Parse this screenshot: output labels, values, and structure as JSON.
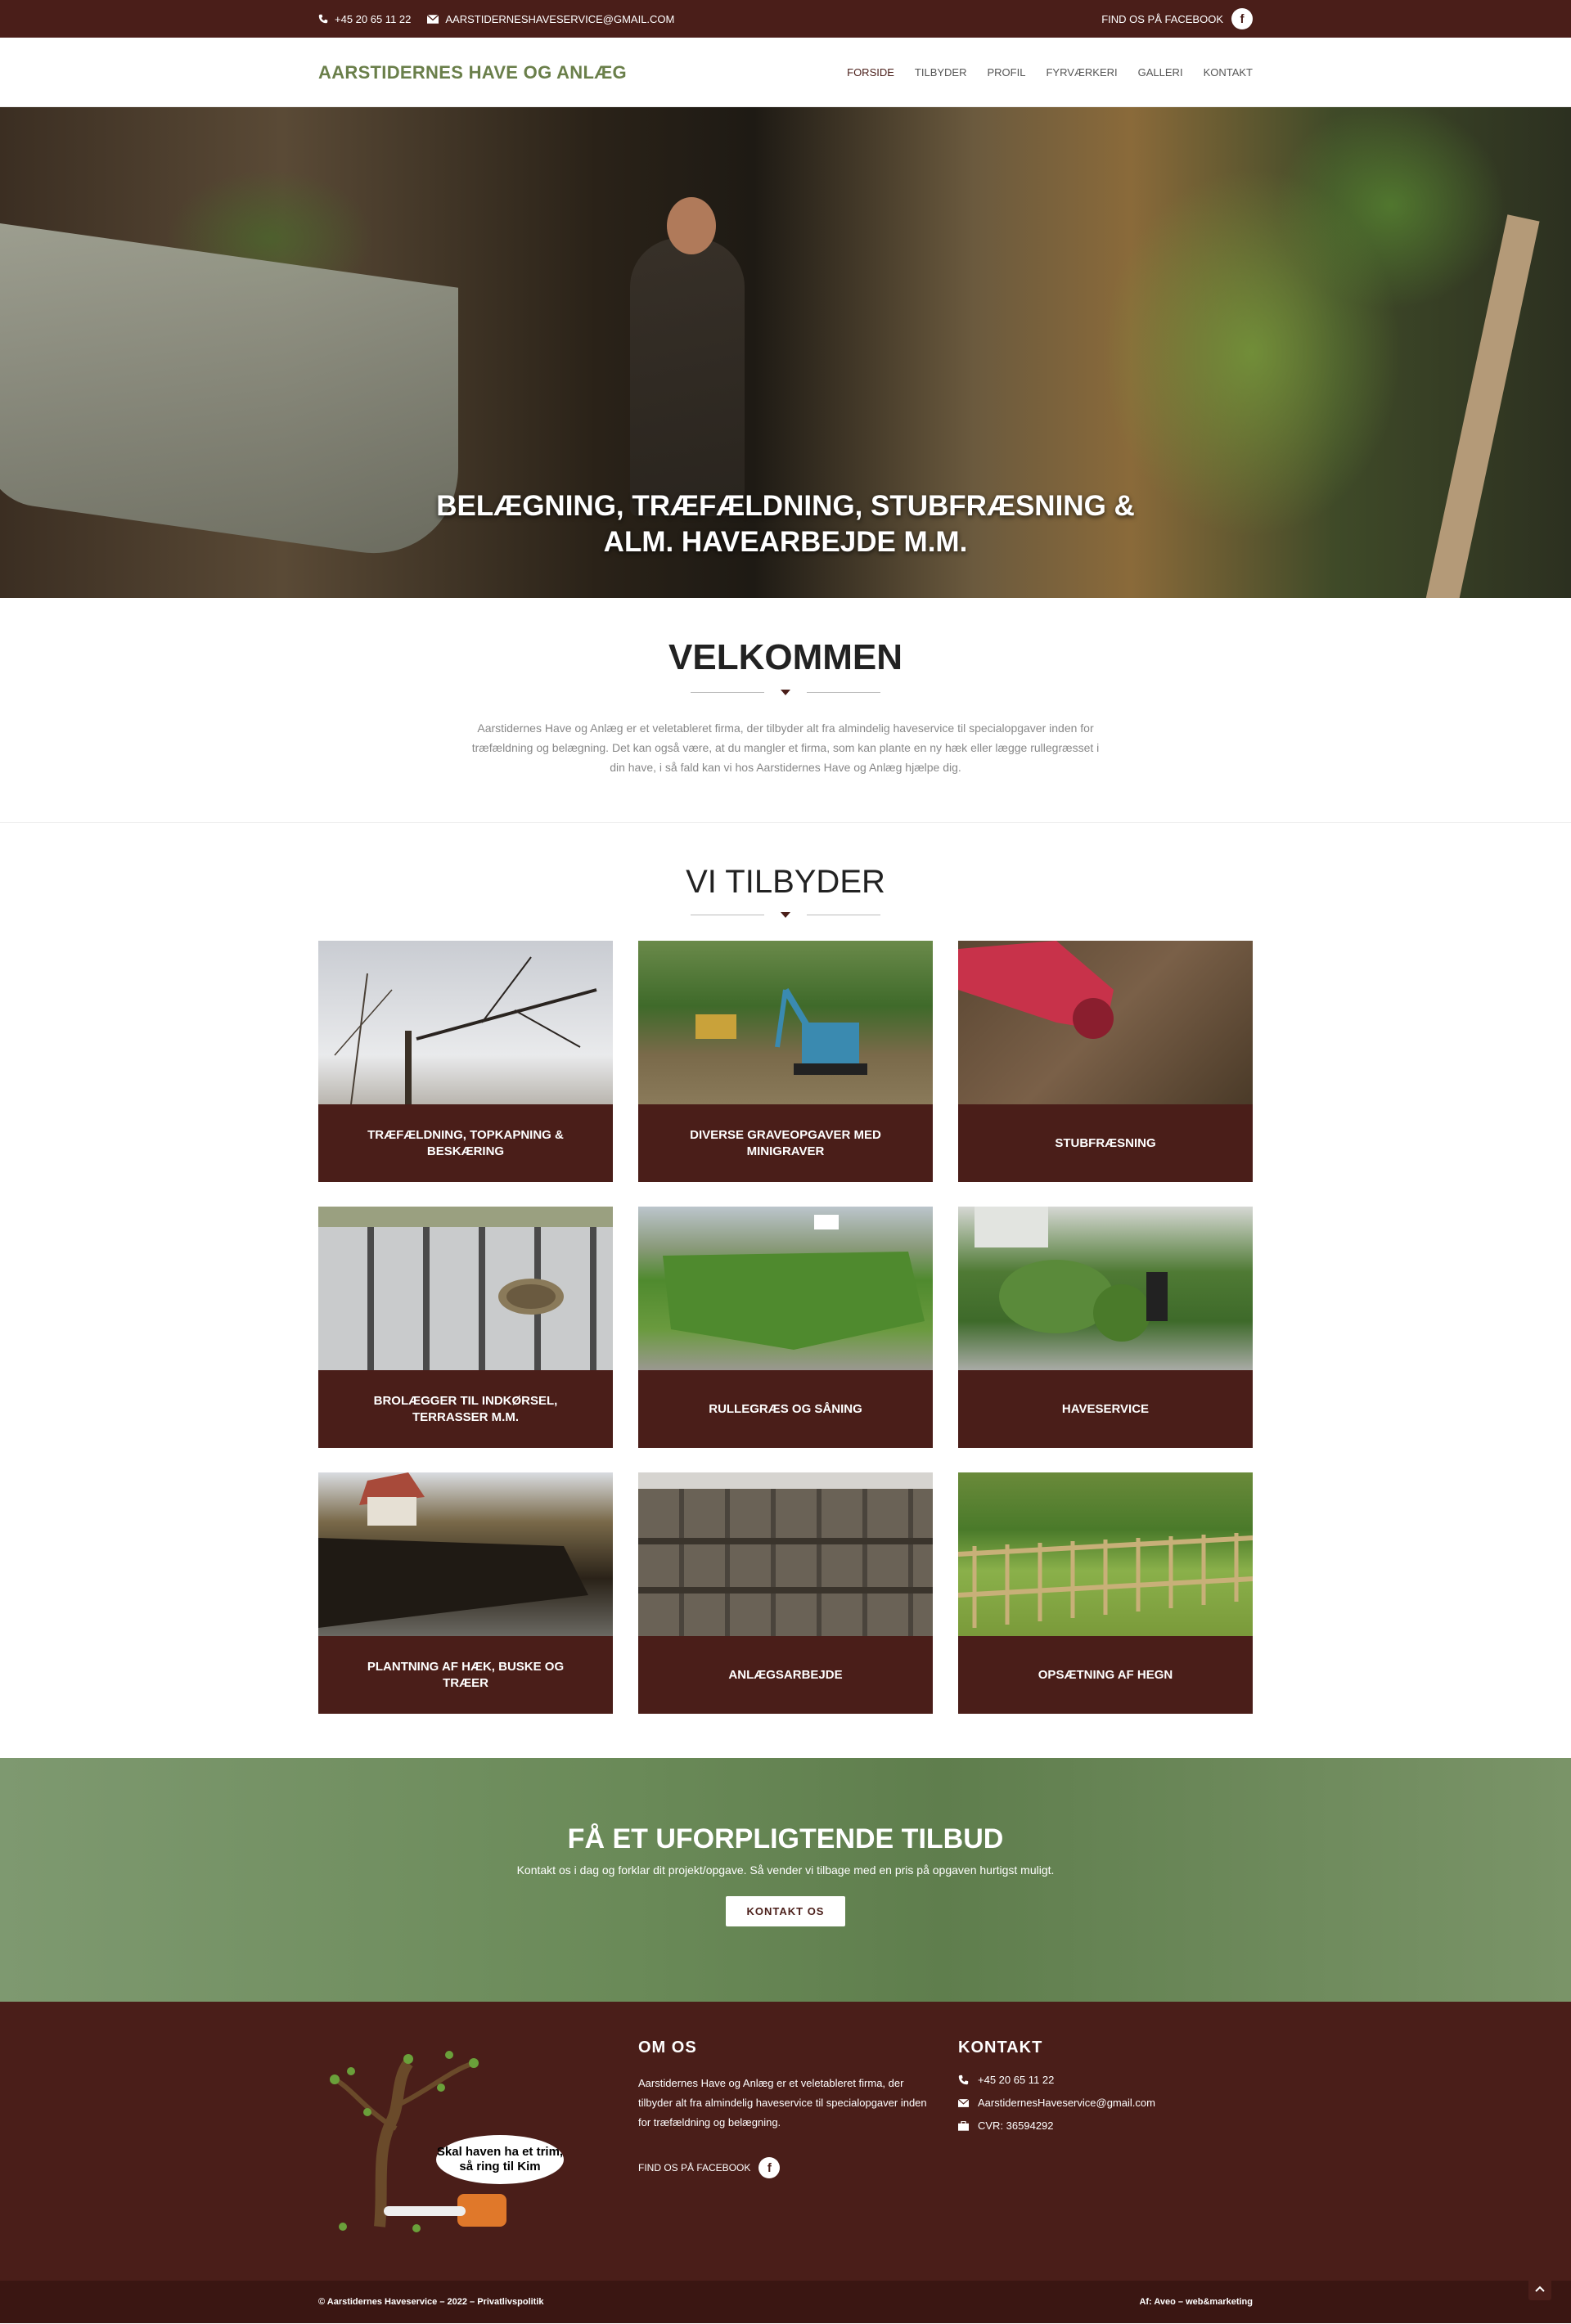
{
  "topbar": {
    "phone": "+45 20 65 11 22",
    "email": "AARSTIDERNESHAVESERVICE@GMAIL.COM",
    "facebook_label": "FIND OS PÅ FACEBOOK",
    "facebook_glyph": "f"
  },
  "header": {
    "logo": "AARSTIDERNES HAVE OG ANLÆG",
    "nav": [
      "FORSIDE",
      "TILBYDER",
      "PROFIL",
      "FYRVÆRKERI",
      "GALLERI",
      "KONTAKT"
    ]
  },
  "hero": {
    "line1": "BELÆGNING, TRÆFÆLDNING, STUBFRÆSNING &",
    "line2": "ALM. HAVEARBEJDE M.M."
  },
  "welcome": {
    "title": "VELKOMMEN",
    "text": "Aarstidernes Have og Anlæg er et veletableret firma, der tilbyder alt fra almindelig haveservice til specialopgaver inden for træfældning og belægning. Det kan også være, at du mangler et firma, som kan plante en ny hæk eller lægge rullegræsset i din have, i så fald kan vi hos Aarstidernes Have og Anlæg hjælpe dig."
  },
  "services": {
    "title": "VI TILBYDER",
    "items": [
      {
        "label": "TRÆFÆLDNING, TOPKAPNING & BESKÆRING"
      },
      {
        "label": "DIVERSE GRAVEOPGAVER MED MINIGRAVER"
      },
      {
        "label": "STUBFRÆSNING"
      },
      {
        "label": "BROLÆGGER TIL INDKØRSEL, TERRASSER M.M."
      },
      {
        "label": "RULLEGRÆS OG SÅNING"
      },
      {
        "label": "HAVESERVICE"
      },
      {
        "label": "PLANTNING AF HÆK, BUSKE OG TRÆER"
      },
      {
        "label": "ANLÆGSARBEJDE"
      },
      {
        "label": "OPSÆTNING AF HEGN"
      }
    ]
  },
  "cta": {
    "title": "FÅ ET UFORPLIGTENDE TILBUD",
    "text": "Kontakt os i dag og forklar dit projekt/opgave. Så vender vi tilbage med en pris på opgaven hurtigst muligt.",
    "button": "KONTAKT OS"
  },
  "footer": {
    "logo_text_1": "Skal haven ha et trim,",
    "logo_text_2": "så ring til Kim",
    "about_title": "OM OS",
    "about_text": "Aarstidernes Have og Anlæg er et veletableret firma, der tilbyder alt fra almindelig haveservice til specialopgaver inden for træfældning og belægning.",
    "facebook_label": "FIND OS PÅ FACEBOOK",
    "contact_title": "KONTAKT",
    "phone": "+45 20 65 11 22",
    "email": "AarstidernesHaveservice@gmail.com",
    "cvr": "CVR: 36594292"
  },
  "bottom": {
    "left": "© Aarstidernes Haveservice – 2022 – Privatlivspolitik",
    "right": "Af: Aveo – web&marketing"
  },
  "colors": {
    "brand": "#4a1e19",
    "logo_green": "#6a7f4a",
    "cta_green": "#6a8a58"
  },
  "icons": [
    "phone-icon",
    "envelope-icon",
    "facebook-icon",
    "briefcase-icon",
    "chevron-up-icon"
  ]
}
